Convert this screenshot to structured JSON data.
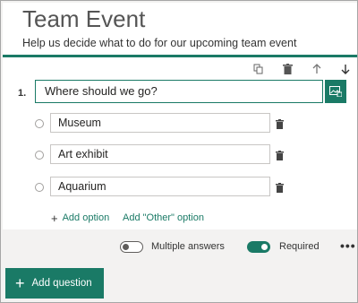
{
  "form": {
    "title": "Team Event",
    "subtitle": "Help us decide what to do for our upcoming team event"
  },
  "toolbar": {
    "icons": [
      "copy-icon",
      "trash-icon",
      "arrow-up-icon",
      "arrow-down-icon"
    ]
  },
  "question": {
    "number": "1.",
    "text": "Where should we go?",
    "options": [
      "Museum",
      "Art exhibit",
      "Aquarium"
    ]
  },
  "links": {
    "add_option": "Add option",
    "add_other": "Add \"Other\" option"
  },
  "settings": {
    "multiple_answers_label": "Multiple answers",
    "multiple_answers_on": false,
    "required_label": "Required",
    "required_on": true,
    "more": "•••"
  },
  "add_question": {
    "label": "Add question"
  },
  "colors": {
    "accent": "#1a7a66"
  }
}
